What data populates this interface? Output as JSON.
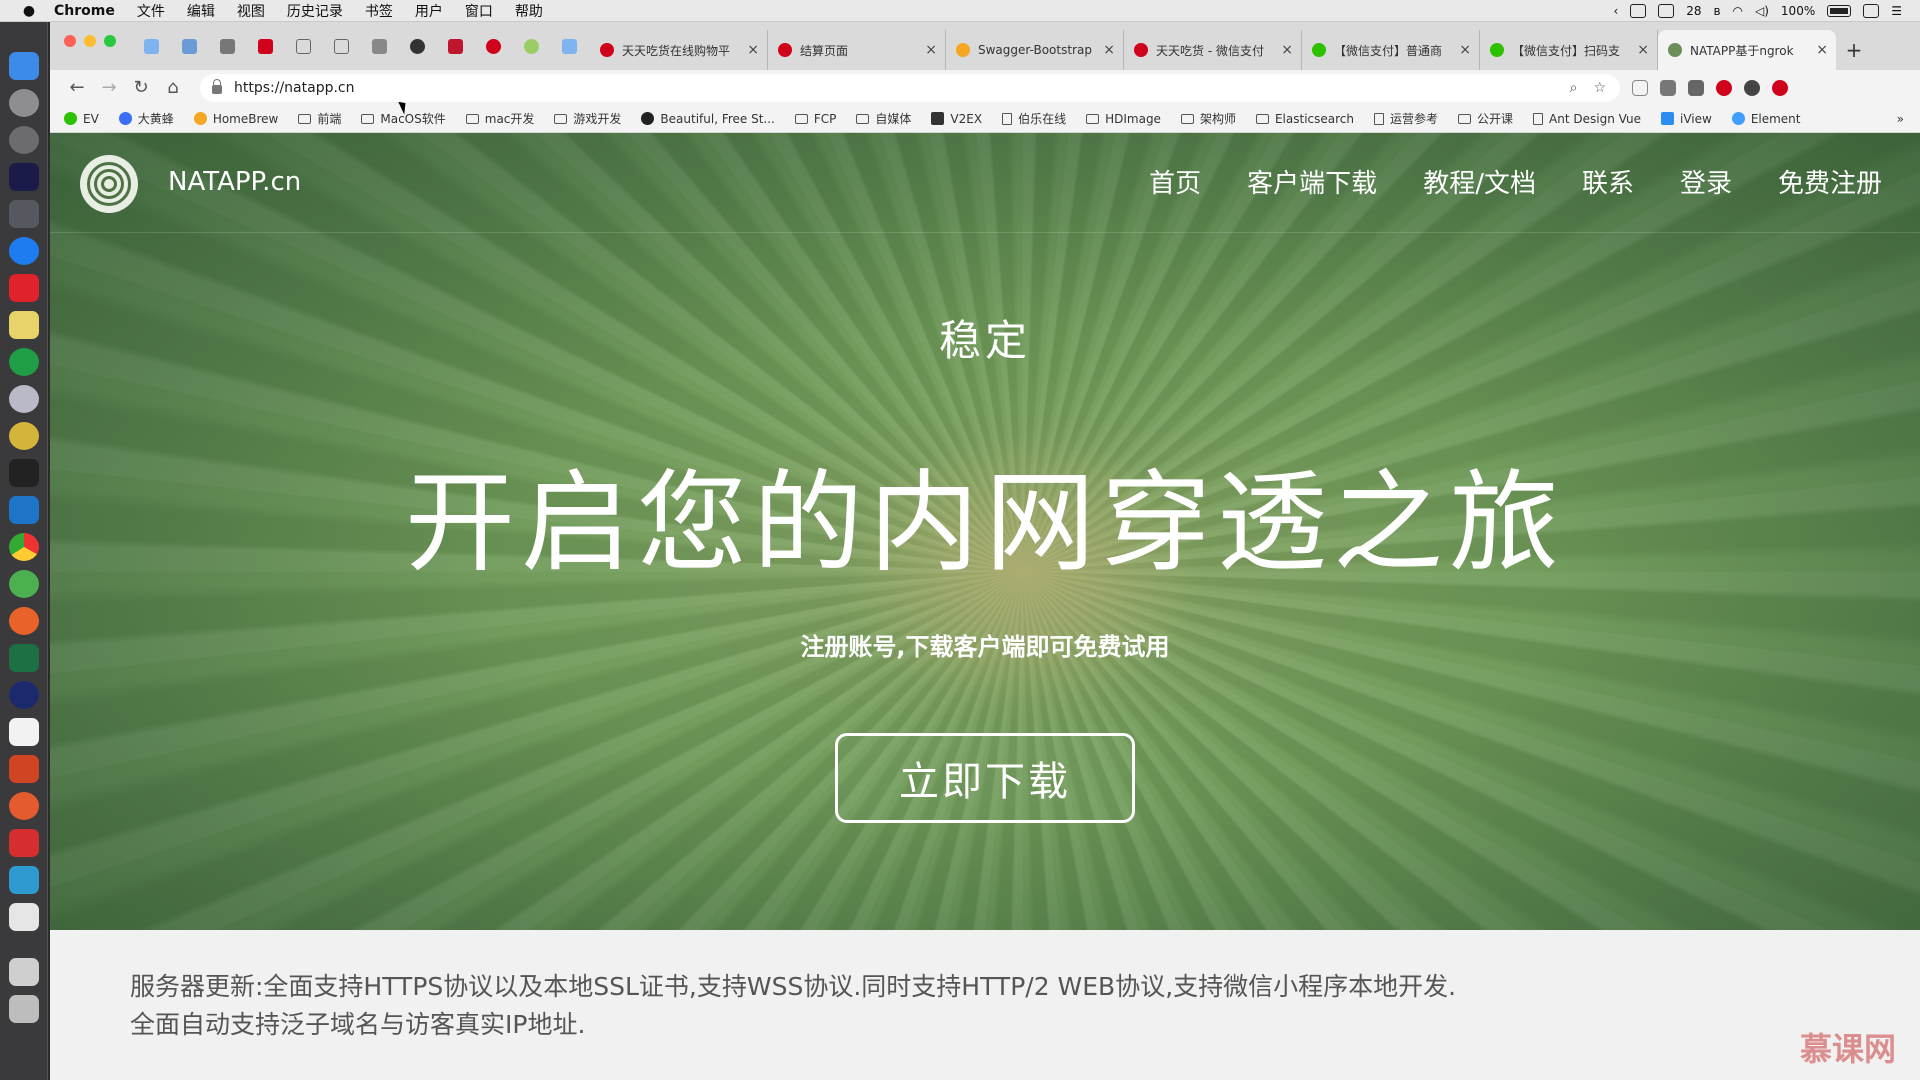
{
  "menubar": {
    "app_name": "Chrome",
    "items": [
      "文件",
      "编辑",
      "视图",
      "历史记录",
      "书签",
      "用户",
      "窗口",
      "帮助"
    ],
    "status_numbers": "28",
    "battery": "100%"
  },
  "tabs": [
    {
      "label": "天天吃货在线购物平",
      "favicon_color": "#d0021b"
    },
    {
      "label": "结算页面",
      "favicon_color": "#d0021b"
    },
    {
      "label": "Swagger-Bootstrap",
      "favicon_color": "#f5a623"
    },
    {
      "label": "天天吃货 - 微信支付",
      "favicon_color": "#d0021b"
    },
    {
      "label": "【微信支付】普通商",
      "favicon_color": "#2dc100"
    },
    {
      "label": "【微信支付】扫码支",
      "favicon_color": "#2dc100"
    },
    {
      "label": "NATAPP基于ngrok",
      "favicon_color": "#6b8e5a"
    }
  ],
  "address_bar": {
    "url": "https://natapp.cn"
  },
  "bookmarks": [
    {
      "label": "EV",
      "kind": "fav",
      "color": "#2dc100"
    },
    {
      "label": "大黄蜂",
      "kind": "fav",
      "color": "#3b6ef5"
    },
    {
      "label": "HomeBrew",
      "kind": "fav",
      "color": "#f5a623"
    },
    {
      "label": "前端",
      "kind": "folder"
    },
    {
      "label": "MacOS软件",
      "kind": "folder"
    },
    {
      "label": "mac开发",
      "kind": "folder"
    },
    {
      "label": "游戏开发",
      "kind": "folder"
    },
    {
      "label": "Beautiful, Free St...",
      "kind": "fav",
      "color": "#222222"
    },
    {
      "label": "FCP",
      "kind": "folder"
    },
    {
      "label": "自媒体",
      "kind": "folder"
    },
    {
      "label": "V2EX",
      "kind": "fav",
      "color": "#333333"
    },
    {
      "label": "伯乐在线",
      "kind": "file"
    },
    {
      "label": "HDImage",
      "kind": "folder"
    },
    {
      "label": "架构师",
      "kind": "folder"
    },
    {
      "label": "Elasticsearch",
      "kind": "folder"
    },
    {
      "label": "运营参考",
      "kind": "file"
    },
    {
      "label": "公开课",
      "kind": "folder"
    },
    {
      "label": "Ant Design Vue",
      "kind": "file"
    },
    {
      "label": "iView",
      "kind": "fav",
      "color": "#2d8cf0"
    },
    {
      "label": "Element",
      "kind": "fav",
      "color": "#409eff"
    }
  ],
  "bookmarks_more": "»",
  "site": {
    "brand": "NATAPP.cn",
    "nav": [
      "首页",
      "客户端下载",
      "教程/文档",
      "联系",
      "登录",
      "免费注册"
    ],
    "eyebrow": "稳定",
    "headline": "开启您的内网穿透之旅",
    "subline": "注册账号,下载客户端即可免费试用",
    "cta": "立即下载",
    "notice_line1": "服务器更新:全面支持HTTPS协议以及本地SSL证书,支持WSS协议.同时支持HTTP/2 WEB协议,支持微信小程序本地开发.",
    "notice_line2": "全面自动支持泛子域名与访客真实IP地址."
  },
  "watermark": "慕课网",
  "colors": {
    "hero_green": "#6f9a58",
    "notice_bg": "#f1f1f1",
    "text_white": "#ffffff"
  }
}
